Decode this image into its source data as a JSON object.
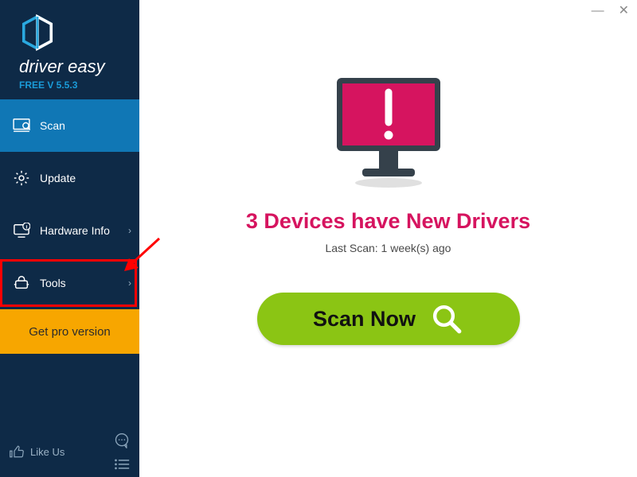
{
  "brand": {
    "name": "driver easy",
    "subtitle": "FREE V 5.5.3"
  },
  "sidebar": {
    "items": [
      {
        "label": "Scan"
      },
      {
        "label": "Update"
      },
      {
        "label": "Hardware Info"
      },
      {
        "label": "Tools"
      }
    ],
    "pro_label": "Get pro version",
    "like_label": "Like Us"
  },
  "main": {
    "status_title": "3 Devices have New Drivers",
    "last_scan": "Last Scan: 1 week(s) ago",
    "scan_button": "Scan Now"
  },
  "colors": {
    "sidebar_bg": "#0e2a47",
    "active_bg": "#1077b5",
    "pro_bg": "#f7a600",
    "scan_bg": "#8bc514",
    "status_fg": "#d6145f"
  }
}
